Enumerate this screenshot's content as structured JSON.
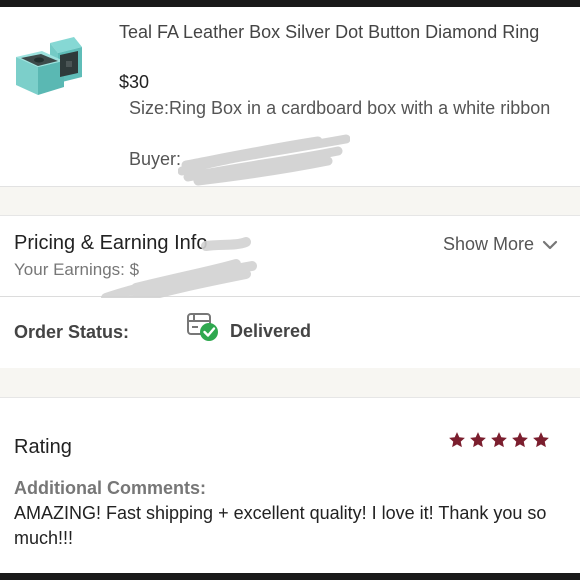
{
  "product": {
    "title": "Teal FA Leather Box Silver Dot Button Diamond Ring",
    "price": "$30",
    "size": "Size:Ring Box in a cardboard box with a white ribbon",
    "buyer": "Buyer: "
  },
  "pricing": {
    "title": "Pricing & Earning Info",
    "earnings_label": "Your Earnings: $",
    "show_more": "Show More"
  },
  "order_status": {
    "label": "Order Status:",
    "value": "Delivered"
  },
  "rating": {
    "title": "Rating",
    "stars": 5,
    "star_color": "#7b1e2e",
    "comments_title": "Additional Comments:",
    "comments": "AMAZING! Fast shipping + excellent quality! I love it! Thank you so much!!!"
  },
  "colors": {
    "teal": "#7fd3cf",
    "delivered_check": "#2fa84f"
  }
}
